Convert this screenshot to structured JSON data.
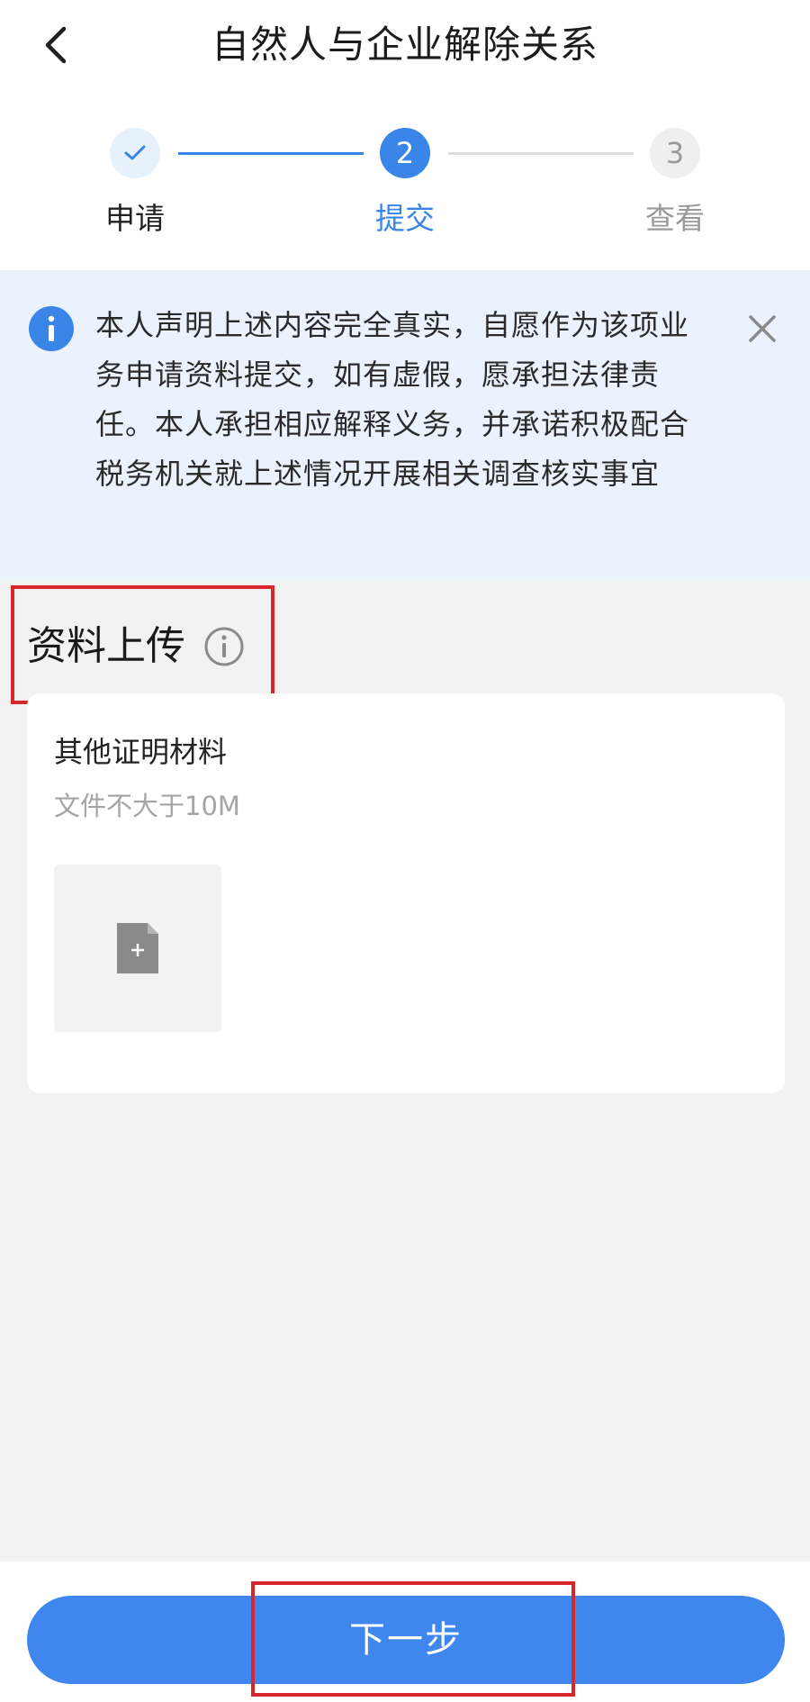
{
  "header": {
    "title": "自然人与企业解除关系",
    "back_icon": "chevron-left-icon"
  },
  "steps": [
    {
      "index": "1",
      "label": "申请",
      "state": "done",
      "icon": "check-icon"
    },
    {
      "index": "2",
      "label": "提交",
      "state": "active"
    },
    {
      "index": "3",
      "label": "查看",
      "state": "pending"
    }
  ],
  "notice": {
    "text": "本人声明上述内容完全真实，自愿作为该项业务申请资料提交，如有虚假，愿承担法律责任。本人承担相应解释义务，并承诺积极配合税务机关就上述情况开展相关调查核实事宜",
    "icon": "info-icon",
    "close_icon": "close-icon"
  },
  "upload_section": {
    "title": "资料上传",
    "title_icon": "info-outline-icon",
    "item_title": "其他证明材料",
    "item_hint": "文件不大于10M",
    "tile_icon": "add-file-icon"
  },
  "footer": {
    "next_label": "下一步"
  },
  "colors": {
    "primary": "#3a86e8",
    "notice_bg": "#eaf3fd",
    "highlight": "#d8262e",
    "page_bg": "#f2f2f2"
  }
}
